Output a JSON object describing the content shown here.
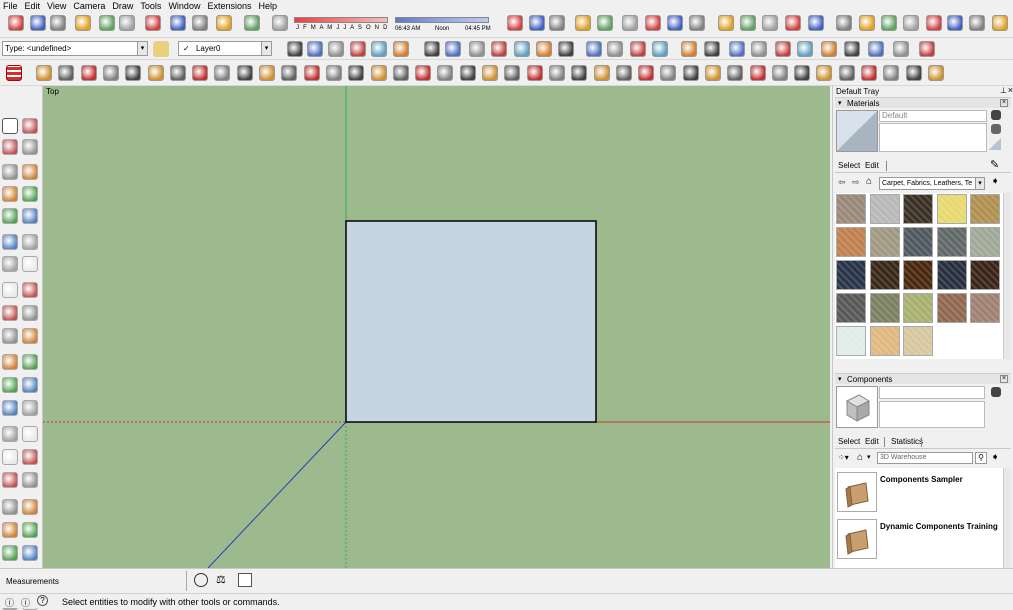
{
  "menu": [
    "File",
    "Edit",
    "View",
    "Camera",
    "Draw",
    "Tools",
    "Window",
    "Extensions",
    "Help"
  ],
  "shadow_bar": {
    "months": "J F M A M J J A S O N D",
    "time_start": "06:43 AM",
    "time_mid": "Noon",
    "time_end": "04:45 PM"
  },
  "entity_type": "Type: <undefined>",
  "layer": {
    "check": "✓",
    "name": "Layer0"
  },
  "viewport": {
    "view_label": "Top",
    "colors": {
      "ground": "#9dba8e",
      "face": "#c5d6e2",
      "red_axis": "#c43a2a",
      "green_axis": "#2bb34a",
      "blue_axis": "#2a3fb5"
    }
  },
  "tray": {
    "title": "Default Tray",
    "materials": {
      "title": "Materials",
      "current_name": "Default",
      "tabs": [
        "Select",
        "Edit"
      ],
      "library": "Carpet, Fabrics, Leathers, Te",
      "swatch_colors": [
        "#9a8878",
        "#b8b8b8",
        "#3b3025",
        "#e8d870",
        "#b09050",
        "#c08050",
        "#a09880",
        "#505860",
        "#606868",
        "#a0a898",
        "#283448",
        "#382818",
        "#4a2810",
        "#283040",
        "#3a2418",
        "#585858",
        "#7a8060",
        "#a8b070",
        "#906850",
        "#a08070",
        "#e0ece8",
        "#e0b880",
        "#d8c8a0"
      ]
    },
    "components": {
      "title": "Components",
      "tabs": [
        "Select",
        "Edit",
        "Statistics"
      ],
      "search_placeholder": "3D Warehouse",
      "items": [
        {
          "label": "Components Sampler"
        },
        {
          "label": "Dynamic Components Training"
        }
      ]
    }
  },
  "statusbar": {
    "measurements_label": "Measurements",
    "hint": "Select entities to modify with other tools or commands."
  },
  "icons": {
    "close": "×",
    "pin": "⊥",
    "left_arrow": "⇦",
    "right_arrow": "⇨",
    "home": "⌂",
    "info": "ⓘ",
    "question": "?"
  }
}
